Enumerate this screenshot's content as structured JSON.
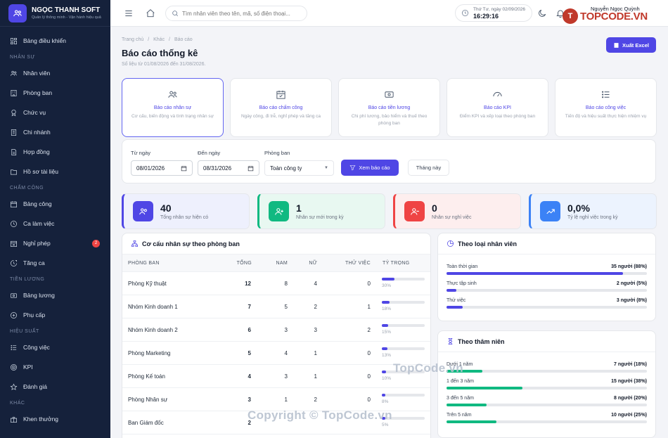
{
  "brand": {
    "name": "NGỌC THANH SOFT",
    "tagline": "Quản lý thông minh - Vận hành hiệu quả"
  },
  "sidebar": {
    "dashboard": "Bảng điều khiển",
    "sections": [
      {
        "title": "NHÂN SỰ",
        "items": [
          {
            "label": "Nhân viên",
            "icon": "users-icon"
          },
          {
            "label": "Phòng ban",
            "icon": "building-icon"
          },
          {
            "label": "Chức vụ",
            "icon": "award-icon"
          },
          {
            "label": "Chi nhánh",
            "icon": "branch-icon"
          },
          {
            "label": "Hợp đồng",
            "icon": "contract-icon"
          },
          {
            "label": "Hồ sơ tài liệu",
            "icon": "folder-icon"
          }
        ]
      },
      {
        "title": "CHẤM CÔNG",
        "items": [
          {
            "label": "Bảng công",
            "icon": "calendar-icon"
          },
          {
            "label": "Ca làm việc",
            "icon": "clock-icon"
          },
          {
            "label": "Nghỉ phép",
            "icon": "leave-icon",
            "badge": "2"
          },
          {
            "label": "Tăng ca",
            "icon": "overtime-icon"
          }
        ]
      },
      {
        "title": "TIỀN LƯƠNG",
        "items": [
          {
            "label": "Bảng lương",
            "icon": "money-icon"
          },
          {
            "label": "Phụ cấp",
            "icon": "plus-circle-icon"
          }
        ]
      },
      {
        "title": "HIỆU SUẤT",
        "items": [
          {
            "label": "Công việc",
            "icon": "list-icon"
          },
          {
            "label": "KPI",
            "icon": "target-icon"
          },
          {
            "label": "Đánh giá",
            "icon": "star-icon"
          }
        ]
      },
      {
        "title": "KHÁC",
        "items": [
          {
            "label": "Khen thưởng",
            "icon": "gift-icon"
          }
        ]
      }
    ]
  },
  "topbar": {
    "search_placeholder": "Tìm nhân viên theo tên, mã, số điện thoại...",
    "clock_date": "Thứ Tư, ngày 02/09/2026",
    "clock_time": "16:29:16",
    "user_name": "Nguyễn Ngọc Quỳnh"
  },
  "watermark": {
    "logo": "TOPCODE.VN",
    "logo_mark": "T",
    "center": "TopCode.vn",
    "bottom": "Copyright © TopCode.vn"
  },
  "page": {
    "breadcrumb": [
      "Trang chủ",
      "/",
      "Khác",
      "/",
      "Báo cáo"
    ],
    "title": "Báo cáo thống kê",
    "subtitle": "Số liệu từ 01/08/2026 đến 31/08/2026.",
    "export_label": "Xuất Excel"
  },
  "report_types": [
    {
      "title": "Báo cáo nhân sự",
      "desc": "Cơ cấu, biến động và tình trạng nhân sự",
      "icon": "users-icon"
    },
    {
      "title": "Báo cáo chấm công",
      "desc": "Ngày công, đi trễ, nghỉ phép và tăng ca",
      "icon": "calendar-check-icon"
    },
    {
      "title": "Báo cáo tiền lương",
      "desc": "Chi phí lương, bảo hiểm và thuế theo phòng ban",
      "icon": "money-icon"
    },
    {
      "title": "Báo cáo KPI",
      "desc": "Điểm KPI và xếp loại theo phòng ban",
      "icon": "gauge-icon"
    },
    {
      "title": "Báo cáo công việc",
      "desc": "Tiến độ và hiệu suất thực hiện nhiệm vụ",
      "icon": "list-icon"
    }
  ],
  "filters": {
    "from_label": "Từ ngày",
    "from_value": "08/01/2026",
    "to_label": "Đến ngày",
    "to_value": "08/31/2026",
    "dept_label": "Phòng ban",
    "dept_value": "Toàn công ty",
    "view_label": "Xem báo cáo",
    "month_label": "Tháng này"
  },
  "stats": [
    {
      "value": "40",
      "label": "Tổng nhân sự hiện có",
      "color": "#4f46e5",
      "bg": "#eef0fd"
    },
    {
      "value": "1",
      "label": "Nhân sự mới trong kỳ",
      "color": "#10b981",
      "bg": "#e8f8f1"
    },
    {
      "value": "0",
      "label": "Nhân sự nghỉ việc",
      "color": "#ef4444",
      "bg": "#fdeeee"
    },
    {
      "value": "0,0%",
      "label": "Tỷ lệ nghỉ việc trong kỳ",
      "color": "#3b82f6",
      "bg": "#ecf3fe"
    }
  ],
  "dept_table": {
    "title": "Cơ cấu nhân sự theo phòng ban",
    "headers": [
      "PHÒNG BAN",
      "TỔNG",
      "NAM",
      "NỮ",
      "THỬ VIỆC",
      "TỶ TRỌNG"
    ],
    "rows": [
      {
        "name": "Phòng Kỹ thuật",
        "total": "12",
        "male": "8",
        "female": "4",
        "probation": "0",
        "pct": "30%",
        "frac": 0.3
      },
      {
        "name": "Nhóm Kinh doanh 1",
        "total": "7",
        "male": "5",
        "female": "2",
        "probation": "1",
        "pct": "18%",
        "frac": 0.18
      },
      {
        "name": "Nhóm Kinh doanh 2",
        "total": "6",
        "male": "3",
        "female": "3",
        "probation": "2",
        "pct": "15%",
        "frac": 0.15
      },
      {
        "name": "Phòng Marketing",
        "total": "5",
        "male": "4",
        "female": "1",
        "probation": "0",
        "pct": "13%",
        "frac": 0.13
      },
      {
        "name": "Phòng Kế toán",
        "total": "4",
        "male": "3",
        "female": "1",
        "probation": "0",
        "pct": "10%",
        "frac": 0.1
      },
      {
        "name": "Phòng Nhân sự",
        "total": "3",
        "male": "1",
        "female": "2",
        "probation": "0",
        "pct": "8%",
        "frac": 0.08
      },
      {
        "name": "Ban Giám đốc",
        "total": "2",
        "male": "",
        "female": "",
        "probation": "",
        "pct": "5%",
        "frac": 0.05
      }
    ]
  },
  "emp_type": {
    "title": "Theo loại nhân viên",
    "rows": [
      {
        "label": "Toàn thời gian",
        "value": "35 người (88%)",
        "frac": 0.88
      },
      {
        "label": "Thực tập sinh",
        "value": "2 người (5%)",
        "frac": 0.05
      },
      {
        "label": "Thử việc",
        "value": "3 người (8%)",
        "frac": 0.08
      }
    ]
  },
  "seniority": {
    "title": "Theo thâm niên",
    "rows": [
      {
        "label": "Dưới 1 năm",
        "value": "7 người (18%)",
        "frac": 0.18
      },
      {
        "label": "1 đến 3 năm",
        "value": "15 người (38%)",
        "frac": 0.38
      },
      {
        "label": "3 đến 5 năm",
        "value": "8 người (20%)",
        "frac": 0.2
      },
      {
        "label": "Trên 5 năm",
        "value": "10 người (25%)",
        "frac": 0.25
      }
    ]
  },
  "colors": {
    "accent": "#4f46e5",
    "green": "#10b981",
    "red": "#ef4444",
    "blue": "#3b82f6",
    "sidebar": "#15213b"
  }
}
